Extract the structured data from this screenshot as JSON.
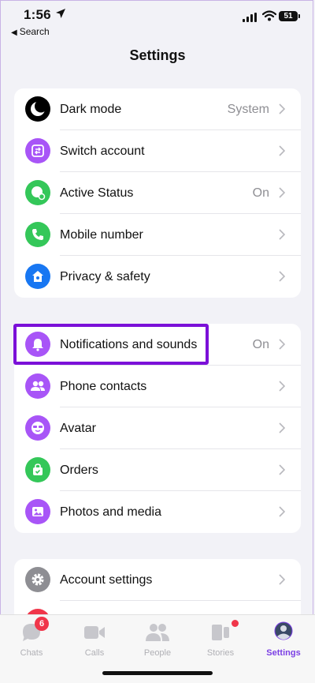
{
  "status_bar": {
    "time": "1:56",
    "back_label": "Search",
    "battery": "51"
  },
  "title": "Settings",
  "sections": [
    [
      {
        "name": "dark-mode",
        "icon": "moon-icon",
        "color": "#000000",
        "label": "Dark mode",
        "value": "System"
      },
      {
        "name": "switch-account",
        "icon": "switch-account-icon",
        "color": "#a855f7",
        "label": "Switch account",
        "value": ""
      },
      {
        "name": "active-status",
        "icon": "active-status-icon",
        "color": "#34c759",
        "label": "Active Status",
        "value": "On"
      },
      {
        "name": "mobile-number",
        "icon": "phone-icon",
        "color": "#34c759",
        "label": "Mobile number",
        "value": ""
      },
      {
        "name": "privacy-safety",
        "icon": "home-shield-icon",
        "color": "#1877f2",
        "label": "Privacy & safety",
        "value": ""
      }
    ],
    [
      {
        "name": "notifications-sounds",
        "icon": "bell-icon",
        "color": "#a855f7",
        "label": "Notifications and sounds",
        "value": "On"
      },
      {
        "name": "phone-contacts",
        "icon": "contacts-icon",
        "color": "#a855f7",
        "label": "Phone contacts",
        "value": ""
      },
      {
        "name": "avatar",
        "icon": "avatar-icon",
        "color": "#a855f7",
        "label": "Avatar",
        "value": ""
      },
      {
        "name": "orders",
        "icon": "bag-icon",
        "color": "#34c759",
        "label": "Orders",
        "value": ""
      },
      {
        "name": "photos-media",
        "icon": "photo-icon",
        "color": "#a855f7",
        "label": "Photos and media",
        "value": ""
      }
    ],
    [
      {
        "name": "account-settings",
        "icon": "gear-icon",
        "color": "#8e8e93",
        "label": "Account settings",
        "value": ""
      }
    ]
  ],
  "tabs": [
    {
      "name": "chats",
      "label": "Chats",
      "icon": "chat-bubble-icon",
      "badge": "6",
      "active": false
    },
    {
      "name": "calls",
      "label": "Calls",
      "icon": "video-camera-icon",
      "badge": "",
      "active": false
    },
    {
      "name": "people",
      "label": "People",
      "icon": "people-icon",
      "badge": "",
      "active": false
    },
    {
      "name": "stories",
      "label": "Stories",
      "icon": "stories-icon",
      "badge": "",
      "active": false
    },
    {
      "name": "settings",
      "label": "Settings",
      "icon": "profile-avatar-icon",
      "badge": "",
      "active": true
    }
  ],
  "colors": {
    "accent": "#7b10d8",
    "active_tab": "#7b3fe4",
    "badge": "#f0364a"
  }
}
